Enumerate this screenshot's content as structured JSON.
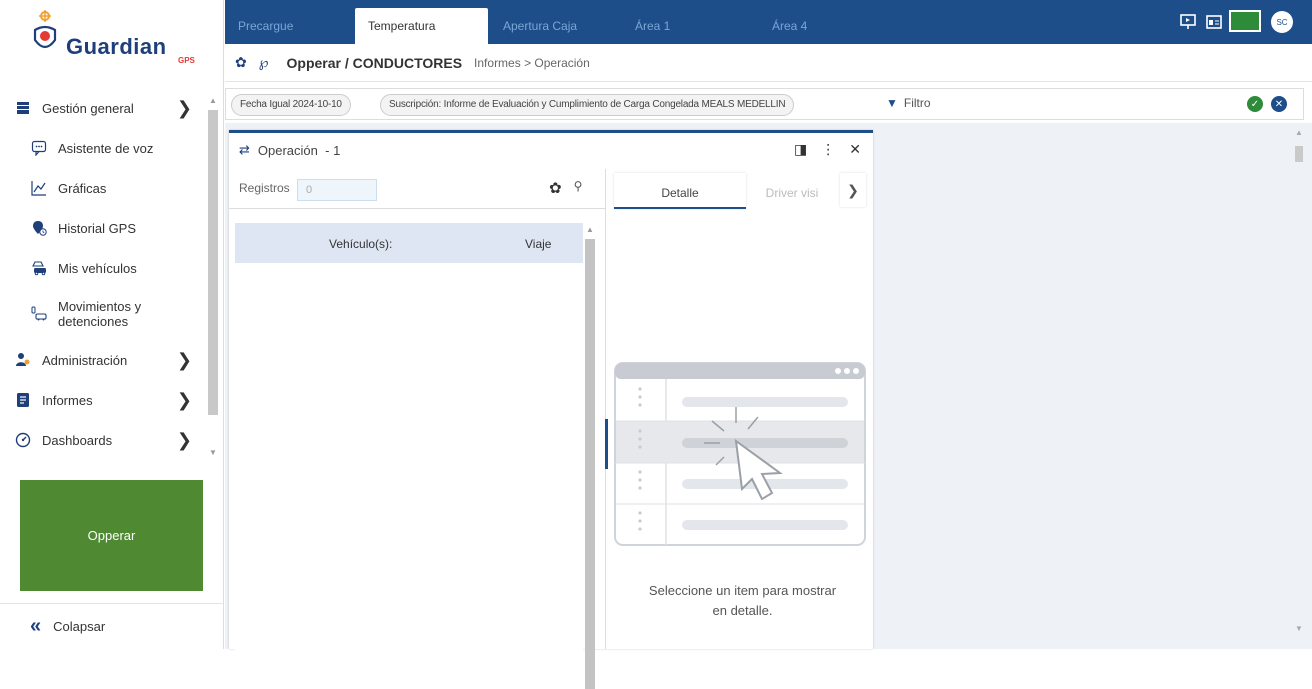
{
  "brand": {
    "name": "Guardian",
    "sub": "GPS"
  },
  "topbar": {
    "tabs": [
      "Precargue",
      "Temperatura",
      "Apertura Caja",
      "Área 1",
      "Área 4"
    ],
    "active_tab": "Temperatura",
    "avatar": "SC"
  },
  "breadcrumb": {
    "main": "Opperar / CONDUCTORES",
    "path": "Informes > Operación"
  },
  "filters": {
    "chips": [
      "Fecha Igual 2024-10-10",
      "Suscripción: Informe de Evaluación y Cumplimiento de Carga Congelada MEALS MEDELLIN"
    ],
    "filter_label": "Filtro"
  },
  "sidebar": {
    "items": [
      {
        "label": "Gestión general",
        "icon": "archive-icon",
        "level": "top",
        "expandable": true
      },
      {
        "label": "Asistente de voz",
        "icon": "chat-icon",
        "level": "sub"
      },
      {
        "label": "Gráficas",
        "icon": "line-chart-icon",
        "level": "sub"
      },
      {
        "label": "Historial GPS",
        "icon": "history-pin-icon",
        "level": "sub"
      },
      {
        "label": "Mis vehículos",
        "icon": "car-icon",
        "level": "sub"
      },
      {
        "label": "Movimientos y",
        "label2": "detenciones",
        "icon": "stop-car-icon",
        "level": "sub"
      },
      {
        "label": "Administración",
        "icon": "users-icon",
        "level": "top",
        "expandable": true
      },
      {
        "label": "Informes",
        "icon": "report-icon",
        "level": "top",
        "expandable": true
      },
      {
        "label": "Dashboards",
        "icon": "gauge-icon",
        "level": "top",
        "expandable": true
      }
    ],
    "promo": "Opperar",
    "collapse": "Colapsar"
  },
  "panel": {
    "title": "Operación",
    "count_suffix": "- 1",
    "registros_label": "Registros",
    "registros_value": "0",
    "columns": [
      "Vehículo(s):",
      "Viaje"
    ],
    "detail_tabs": [
      "Detalle",
      "Driver visi"
    ],
    "empty_line1": "Seleccione un item para mostrar",
    "empty_line2": "en detalle."
  },
  "colors": {
    "primary": "#1d4e89",
    "accent_green": "#4f8a33",
    "header_bg": "#dfe6f3"
  }
}
